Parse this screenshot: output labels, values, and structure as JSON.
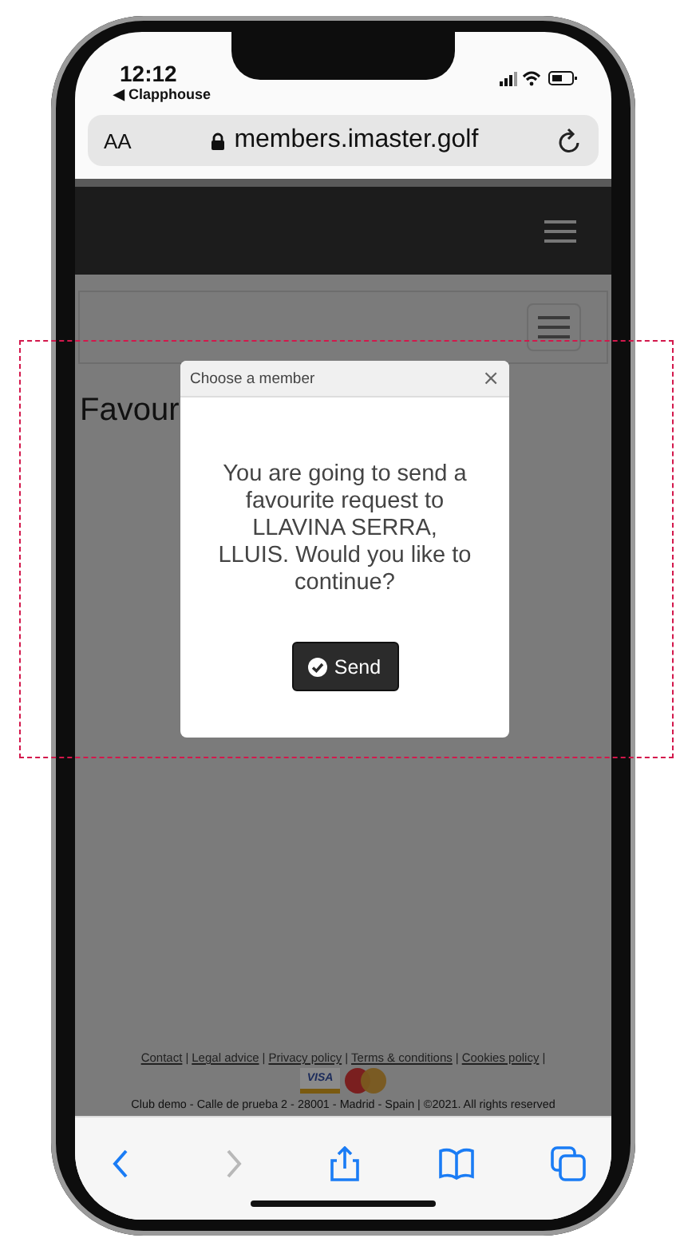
{
  "status_bar": {
    "time": "12:12",
    "back_app": "◀ Clapphouse"
  },
  "address_bar": {
    "text_size": "AA",
    "url": "members.imaster.golf"
  },
  "page": {
    "heading": "Favour"
  },
  "modal": {
    "title": "Choose a member",
    "close": "×",
    "message": "You are going to send a favourite request to LLAVINA SERRA, LLUIS. Would you like to continue?",
    "button": "Send"
  },
  "footer": {
    "links": [
      "Contact",
      "Legal advice",
      "Privacy policy",
      "Terms & conditions",
      "Cookies policy"
    ],
    "separator": "|",
    "card_logo": "VISA",
    "address": "Club demo - Calle de prueba 2 - 28001 - Madrid - Spain | ©2021. All rights reserved"
  },
  "toolbar": [
    {
      "kind": "back",
      "disabled": false
    },
    {
      "kind": "forward",
      "disabled": true
    },
    {
      "kind": "share",
      "disabled": false
    },
    {
      "kind": "bookmarks",
      "disabled": false
    },
    {
      "kind": "tabs",
      "disabled": false
    }
  ]
}
